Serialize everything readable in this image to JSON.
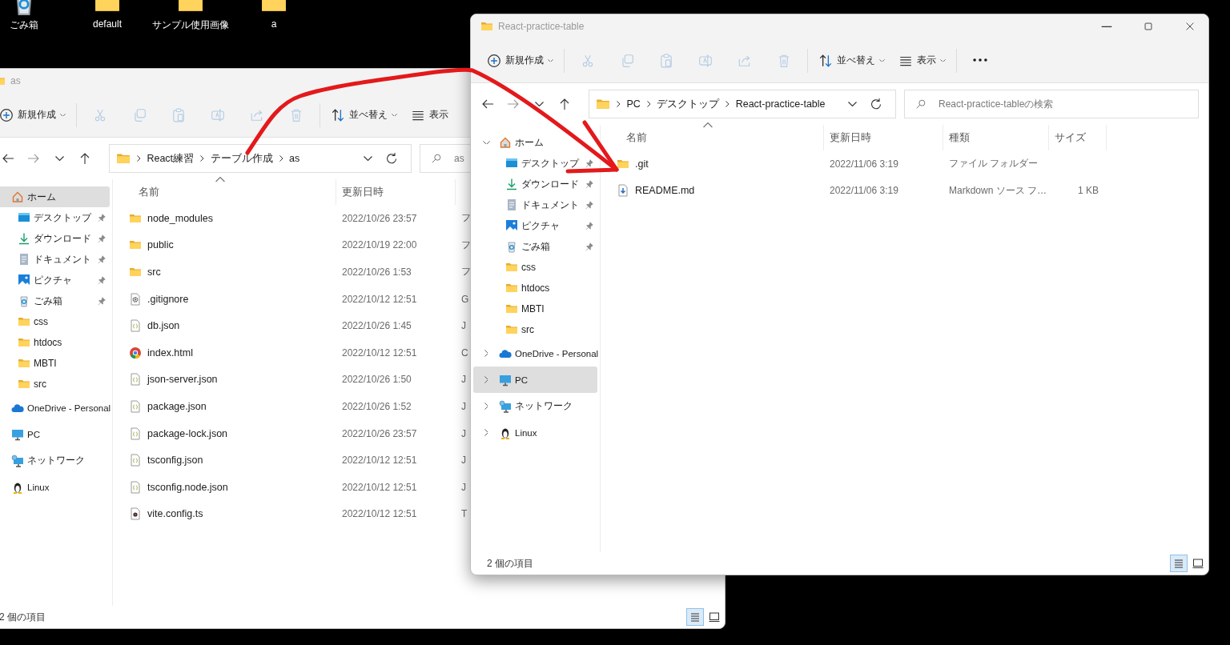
{
  "desktop_icons": [
    {
      "label": "ごみ箱",
      "kind": "recycle"
    },
    {
      "label": "default",
      "kind": "folder-image"
    },
    {
      "label": "サンプル使用画像",
      "kind": "folder-image"
    },
    {
      "label": "a",
      "kind": "folder"
    }
  ],
  "windows": [
    {
      "title": "as",
      "toolbar": [
        {
          "kind": "new",
          "label": "新規作成",
          "dropdown": true,
          "disabled": false
        },
        {
          "kind": "cut",
          "dropdown": false,
          "disabled": true
        },
        {
          "kind": "copy",
          "dropdown": false,
          "disabled": true
        },
        {
          "kind": "paste",
          "dropdown": false,
          "disabled": true
        },
        {
          "kind": "rename",
          "dropdown": false,
          "disabled": true
        },
        {
          "kind": "share",
          "dropdown": false,
          "disabled": true
        },
        {
          "kind": "delete",
          "dropdown": false,
          "disabled": true
        },
        {
          "kind": "sort",
          "label": "並べ替え",
          "dropdown": true,
          "disabled": false
        },
        {
          "kind": "view",
          "label": "表示",
          "dropdown": false,
          "disabled": false
        }
      ],
      "address": [
        "React練習",
        "テーブル作成",
        "as"
      ],
      "search": {
        "placeholder": "as"
      },
      "sidebar": [
        {
          "label": "ホーム",
          "kind": "home",
          "selected": true,
          "children": [
            {
              "label": "デスクトップ",
              "kind": "desktop",
              "pinned": true,
              "selected": false
            },
            {
              "label": "ダウンロード",
              "kind": "download",
              "pinned": true,
              "selected": false
            },
            {
              "label": "ドキュメント",
              "kind": "document",
              "pinned": true,
              "selected": false
            },
            {
              "label": "ピクチャ",
              "kind": "picture",
              "pinned": true,
              "selected": false
            },
            {
              "label": "ごみ箱",
              "kind": "recycle",
              "pinned": true,
              "selected": false
            },
            {
              "label": "css",
              "kind": "folder",
              "pinned": false,
              "selected": false
            },
            {
              "label": "htdocs",
              "kind": "folder",
              "pinned": false,
              "selected": false
            },
            {
              "label": "MBTI",
              "kind": "folder",
              "pinned": false,
              "selected": false
            },
            {
              "label": "src",
              "kind": "folder",
              "pinned": false,
              "selected": false
            }
          ]
        },
        {
          "label": "OneDrive - Personal",
          "kind": "cloud",
          "selected": false
        },
        {
          "label": "PC",
          "kind": "pc",
          "selected": false
        },
        {
          "label": "ネットワーク",
          "kind": "network",
          "selected": false
        },
        {
          "label": "Linux",
          "kind": "linux",
          "selected": false
        }
      ],
      "columns": [
        "名前",
        "更新日時"
      ],
      "rows": [
        {
          "kind": "folder",
          "cells": [
            "node_modules",
            "2022/10/26 23:57",
            "フ"
          ]
        },
        {
          "kind": "folder",
          "cells": [
            "public",
            "2022/10/19 22:00",
            "フ"
          ]
        },
        {
          "kind": "folder",
          "cells": [
            "src",
            "2022/10/26 1:53",
            "フ"
          ]
        },
        {
          "kind": "gearfile",
          "cells": [
            ".gitignore",
            "2022/10/12 12:51",
            "G"
          ]
        },
        {
          "kind": "json",
          "cells": [
            "db.json",
            "2022/10/26 1:45",
            "J"
          ]
        },
        {
          "kind": "browser",
          "cells": [
            "index.html",
            "2022/10/12 12:51",
            "C"
          ]
        },
        {
          "kind": "json",
          "cells": [
            "json-server.json",
            "2022/10/26 1:50",
            "J"
          ]
        },
        {
          "kind": "json",
          "cells": [
            "package.json",
            "2022/10/26 1:52",
            "J"
          ]
        },
        {
          "kind": "json",
          "cells": [
            "package-lock.json",
            "2022/10/26 23:57",
            "J"
          ]
        },
        {
          "kind": "json",
          "cells": [
            "tsconfig.json",
            "2022/10/12 12:51",
            "J"
          ]
        },
        {
          "kind": "json",
          "cells": [
            "tsconfig.node.json",
            "2022/10/12 12:51",
            "J"
          ]
        },
        {
          "kind": "tsfile",
          "cells": [
            "vite.config.ts",
            "2022/10/12 12:51",
            "T"
          ]
        }
      ],
      "status": "2 個の項目",
      "view_modes": [
        {
          "kind": "details",
          "selected": true
        },
        {
          "kind": "tiles",
          "selected": false
        }
      ]
    },
    {
      "title": "React-practice-table",
      "controls": [
        {
          "kind": "minimize"
        },
        {
          "kind": "maximize"
        },
        {
          "kind": "close"
        }
      ],
      "toolbar": [
        {
          "kind": "new",
          "label": "新規作成",
          "dropdown": true,
          "disabled": false
        },
        {
          "kind": "cut",
          "dropdown": false,
          "disabled": true
        },
        {
          "kind": "copy",
          "dropdown": false,
          "disabled": true
        },
        {
          "kind": "paste",
          "dropdown": false,
          "disabled": true
        },
        {
          "kind": "rename",
          "dropdown": false,
          "disabled": true
        },
        {
          "kind": "share",
          "dropdown": false,
          "disabled": true
        },
        {
          "kind": "delete",
          "dropdown": false,
          "disabled": true
        },
        {
          "kind": "sort",
          "label": "並べ替え",
          "dropdown": true,
          "disabled": false
        },
        {
          "kind": "view",
          "label": "表示",
          "dropdown": true,
          "disabled": false
        },
        {
          "kind": "more",
          "dropdown": false,
          "disabled": false
        }
      ],
      "address": [
        "PC",
        "デスクトップ",
        "React-practice-table"
      ],
      "search": {
        "placeholder": "React-practice-tableの検索"
      },
      "sidebar": [
        {
          "label": "ホーム",
          "kind": "home",
          "expanded": true,
          "selected": false,
          "children": [
            {
              "label": "デスクトップ",
              "kind": "desktop",
              "pinned": true,
              "selected": false
            },
            {
              "label": "ダウンロード",
              "kind": "download",
              "pinned": true,
              "selected": false
            },
            {
              "label": "ドキュメント",
              "kind": "document",
              "pinned": true,
              "selected": false
            },
            {
              "label": "ピクチャ",
              "kind": "picture",
              "pinned": true,
              "selected": false
            },
            {
              "label": "ごみ箱",
              "kind": "recycle",
              "pinned": true,
              "selected": false
            },
            {
              "label": "css",
              "kind": "folder",
              "pinned": false,
              "selected": false
            },
            {
              "label": "htdocs",
              "kind": "folder",
              "pinned": false,
              "selected": false
            },
            {
              "label": "MBTI",
              "kind": "folder",
              "pinned": false,
              "selected": false
            },
            {
              "label": "src",
              "kind": "folder",
              "pinned": false,
              "selected": false
            }
          ]
        },
        {
          "label": "OneDrive - Personal",
          "kind": "cloud",
          "expanded": false,
          "selected": false
        },
        {
          "label": "PC",
          "kind": "pc",
          "expanded": false,
          "selected": true
        },
        {
          "label": "ネットワーク",
          "kind": "network",
          "expanded": false,
          "selected": false
        },
        {
          "label": "Linux",
          "kind": "linux",
          "expanded": false,
          "selected": false
        }
      ],
      "columns": [
        "名前",
        "更新日時",
        "種類",
        "サイズ"
      ],
      "rows": [
        {
          "kind": "folder",
          "cells": [
            ".git",
            "2022/11/06 3:19",
            "ファイル フォルダー"
          ]
        },
        {
          "kind": "mdfile",
          "cells": [
            "README.md",
            "2022/11/06 3:19",
            "Markdown ソース フ…",
            "1 KB"
          ]
        }
      ],
      "status": "2 個の項目",
      "view_modes": [
        {
          "kind": "details",
          "selected": true
        },
        {
          "kind": "tiles",
          "selected": false
        }
      ]
    }
  ]
}
